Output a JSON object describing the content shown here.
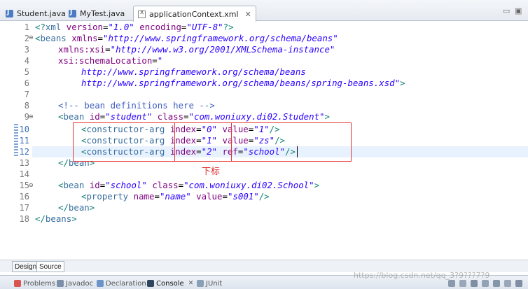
{
  "tabs": [
    {
      "label": "Student.java",
      "icon": "java-file-icon"
    },
    {
      "label": "MyTest.java",
      "icon": "java-file-icon"
    },
    {
      "label": "applicationContext.xml",
      "icon": "xml-file-icon",
      "active": true,
      "close": "✕"
    }
  ],
  "window_controls": {
    "minimize": "▭",
    "maximize": "▣"
  },
  "line_numbers": [
    "1",
    "2",
    "3",
    "4",
    "5",
    "6",
    "7",
    "8",
    "9",
    "10",
    "11",
    "12",
    "13",
    "14",
    "15",
    "16",
    "17",
    "18"
  ],
  "fold_markers": {
    "line2": "⊖",
    "line9": "⊖",
    "line15": "⊖"
  },
  "code": {
    "l1": {
      "p1": "<?",
      "tag": "xml",
      "a1": " version",
      "e1": "=",
      "v1": "\"1.0\"",
      "a2": " encoding",
      "e2": "=",
      "v2": "\"UTF-8\"",
      "p2": "?>"
    },
    "l2": {
      "lt": "<",
      "tag": "beans",
      "a1": " xmlns",
      "e1": "=",
      "v1": "\"http://www.springframework.org/schema/beans\""
    },
    "l3": {
      "a1": "xmlns:xsi",
      "e1": "=",
      "v1": "\"http://www.w3.org/2001/XMLSchema-instance\""
    },
    "l4": {
      "a1": "xsi:schemaLocation",
      "e1": "=",
      "v1": "\""
    },
    "l5": {
      "v1": "http://www.springframework.org/schema/beans"
    },
    "l6": {
      "v1": "http://www.springframework.org/schema/beans/spring-beans.xsd\"",
      "gt": ">"
    },
    "l8": {
      "cm": "<!-- bean definitions here -->"
    },
    "l9": {
      "lt": "<",
      "tag": "bean",
      "a1": " id",
      "e1": "=",
      "v1": "\"student\"",
      "a2": " class",
      "e2": "=",
      "v2": "\"com.woniuxy.di02.Student\"",
      "gt": ">"
    },
    "l10": {
      "lt": "<",
      "tag": "constructor-arg",
      "a1": " index",
      "e1": "=",
      "v1": "\"0\"",
      "a2": " value",
      "e2": "=",
      "v2": "\"1\"",
      "gt": "/>"
    },
    "l11": {
      "lt": "<",
      "tag": "constructor-arg",
      "a1": " index",
      "e1": "=",
      "v1": "\"1\"",
      "a2": " value",
      "e2": "=",
      "v2": "\"zs\"",
      "gt": "/>"
    },
    "l12": {
      "lt": "<",
      "tag": "constructor-arg",
      "a1": " index",
      "e1": "=",
      "v1": "\"2\"",
      "a2": " ref",
      "e2": "=",
      "v2": "\"school\"",
      "gt": "/>"
    },
    "l13": {
      "lt": "</",
      "tag": "bean",
      "gt": ">"
    },
    "l15": {
      "lt": "<",
      "tag": "bean",
      "a1": " id",
      "e1": "=",
      "v1": "\"school\"",
      "a2": " class",
      "e2": "=",
      "v2": "\"com.woniuxy.di02.School\"",
      "gt": ">"
    },
    "l16": {
      "lt": "<",
      "tag": "property",
      "a1": " name",
      "e1": "=",
      "v1": "\"name\"",
      "a2": " value",
      "e2": "=",
      "v2": "\"s001\"",
      "gt": "/>"
    },
    "l17": {
      "lt": "</",
      "tag": "bean",
      "gt": ">"
    },
    "l18": {
      "lt": "</",
      "tag": "beans",
      "gt": ">"
    }
  },
  "annotation": {
    "label": "下标",
    "color": "#e53333"
  },
  "editor_mode_tabs": {
    "design": "Design",
    "source": "Source"
  },
  "views": [
    {
      "label": "Problems",
      "icon": "problems-icon"
    },
    {
      "label": "Javadoc",
      "icon": "javadoc-icon"
    },
    {
      "label": "Declaration",
      "icon": "declaration-icon"
    },
    {
      "label": "Console",
      "icon": "console-icon",
      "active": true
    },
    {
      "label": "JUnit",
      "icon": "junit-icon"
    }
  ],
  "view_close": "✕",
  "watermark": "https://blog.csdn.net/qq_3?9???7?9"
}
